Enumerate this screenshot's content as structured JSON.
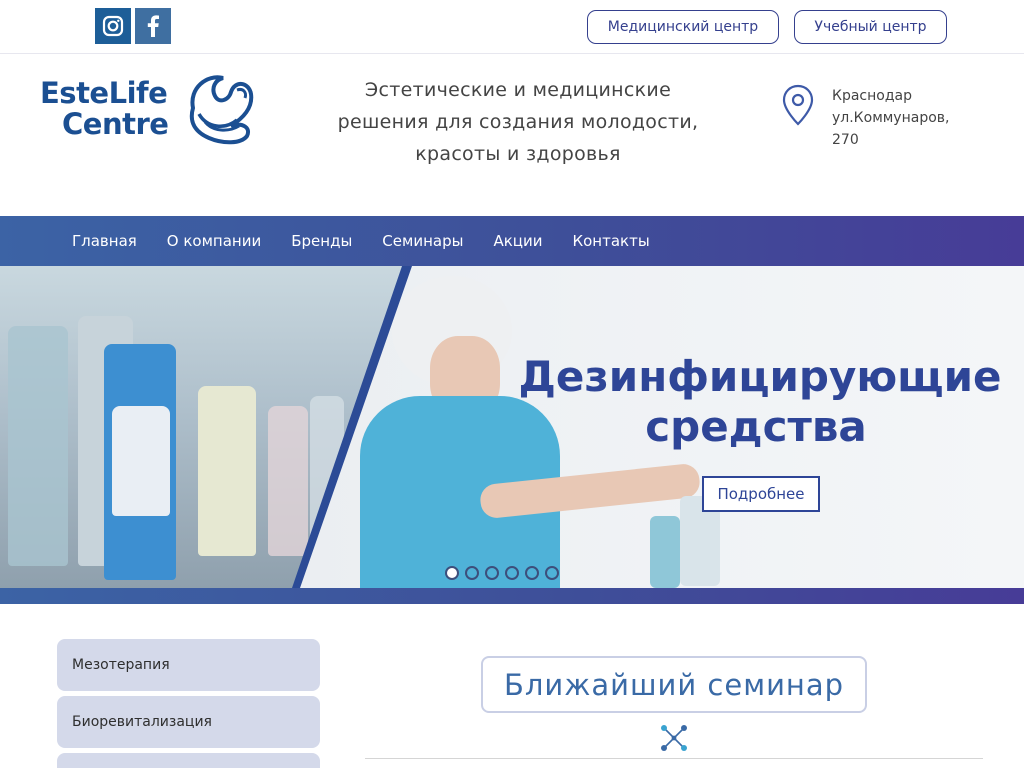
{
  "topbar": {
    "social": [
      {
        "icon": "instagram-icon"
      },
      {
        "icon": "facebook-icon"
      }
    ],
    "buttons": {
      "medical": "Медицинский центр",
      "education": "Учебный центр"
    }
  },
  "header": {
    "logo": {
      "line1": "EsteLife",
      "line2": "Centre"
    },
    "tagline": [
      "Эстетические и медицинские",
      "решения для создания молодости,",
      "красоты и здоровья"
    ],
    "address": [
      "Краснодар",
      "ул.Коммунаров,",
      "270"
    ]
  },
  "nav": {
    "items": [
      "Главная",
      "О компании",
      "Бренды",
      "Семинары",
      "Акции",
      "Контакты"
    ]
  },
  "slider": {
    "title_line1": "Дезинфицирующие",
    "title_line2": "средства",
    "button": "Подробнее",
    "slide_count": 6,
    "active_slide": 1
  },
  "sidebar": {
    "items": [
      "Мезотерапия",
      "Биоревитализация"
    ]
  },
  "seminar": {
    "heading": "Ближайший семинар"
  },
  "colors": {
    "brand": "#1b4f92",
    "nav_start": "#3c63a5",
    "nav_end": "#473c97",
    "sidebar_bg": "#d4d9ea",
    "heading": "#3a6aa6"
  }
}
